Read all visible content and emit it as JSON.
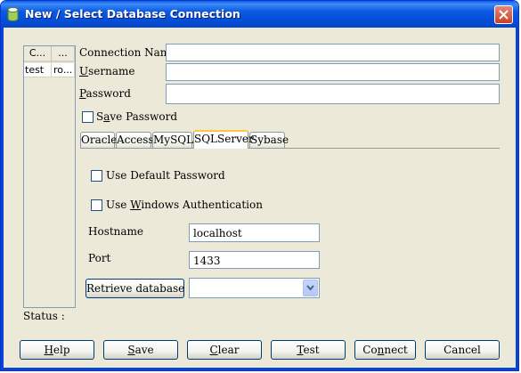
{
  "window": {
    "title": "New / Select Database Connection"
  },
  "connections": {
    "columns": [
      "C...",
      "..."
    ],
    "rows": [
      [
        "test",
        "ro..."
      ]
    ]
  },
  "form": {
    "connection_name_label": "Connection Name",
    "connection_name_value": "",
    "username_label_pre": "",
    "username_label_key": "U",
    "username_label_post": "sername",
    "username_value": "",
    "password_label_key": "P",
    "password_label_post": "assword",
    "password_value": "",
    "save_password_pre": "S",
    "save_password_key": "a",
    "save_password_post": "ve Password",
    "save_password_checked": false
  },
  "tabs": [
    "Oracle",
    "Access",
    "MySQL",
    "SQLServer",
    "Sybase"
  ],
  "active_tab": "SQLServer",
  "sqlserver": {
    "use_default_password_label": "Use Default Password",
    "use_windows_auth_pre": "Use ",
    "use_windows_auth_key": "W",
    "use_windows_auth_post": "indows Authentication",
    "hostname_label": "Hostname",
    "hostname_value": "localhost",
    "port_label": "Port",
    "port_value": "1433",
    "retrieve_button": "Retrieve database",
    "database_value": ""
  },
  "status_label": "Status :",
  "buttons": {
    "help_key": "H",
    "help_rest": "elp",
    "save_key": "S",
    "save_rest": "ave",
    "clear_key": "C",
    "clear_rest": "lear",
    "test_key": "T",
    "test_rest": "est",
    "connect_pre": "Co",
    "connect_key": "n",
    "connect_rest": "nect",
    "cancel": "Cancel"
  },
  "colors": {
    "title_bar": "#0550d8",
    "dialog_bg": "#ece9d8",
    "active_tab_accent": "#ffc83c"
  }
}
